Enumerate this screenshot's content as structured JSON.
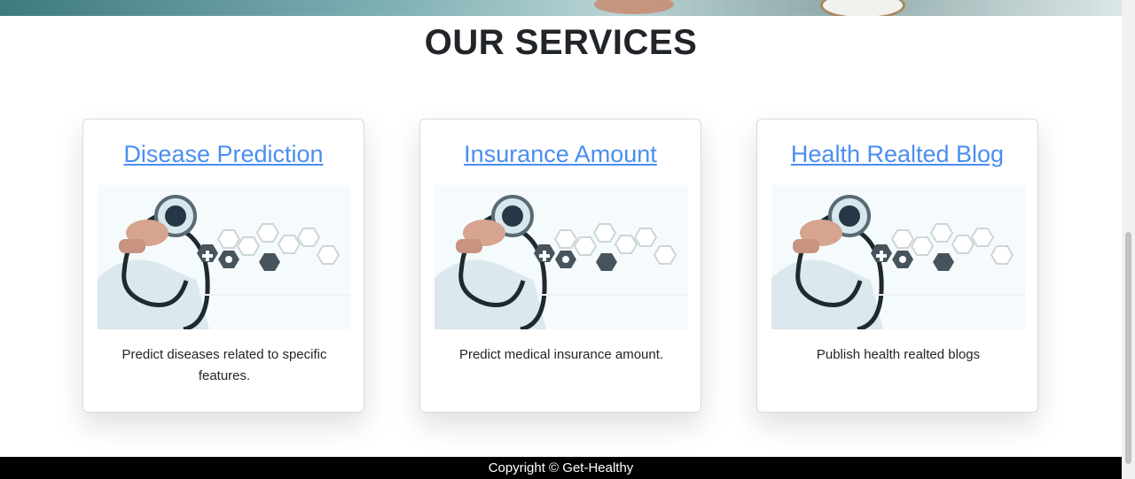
{
  "services_section": {
    "heading": "OUR SERVICES",
    "cards": [
      {
        "title": "Disease Prediction",
        "description": "Predict diseases related to specific features."
      },
      {
        "title": "Insurance Amount",
        "description": "Predict medical insurance amount."
      },
      {
        "title": "Health Realted Blog",
        "description": "Publish health realted blogs"
      }
    ]
  },
  "footer": {
    "text": "Copyright © Get-Healthy"
  },
  "colors": {
    "link": "#4a8ef0",
    "heading": "#212529",
    "footer_bg": "#000000"
  },
  "icons": [
    "stethoscope-medical-image"
  ]
}
